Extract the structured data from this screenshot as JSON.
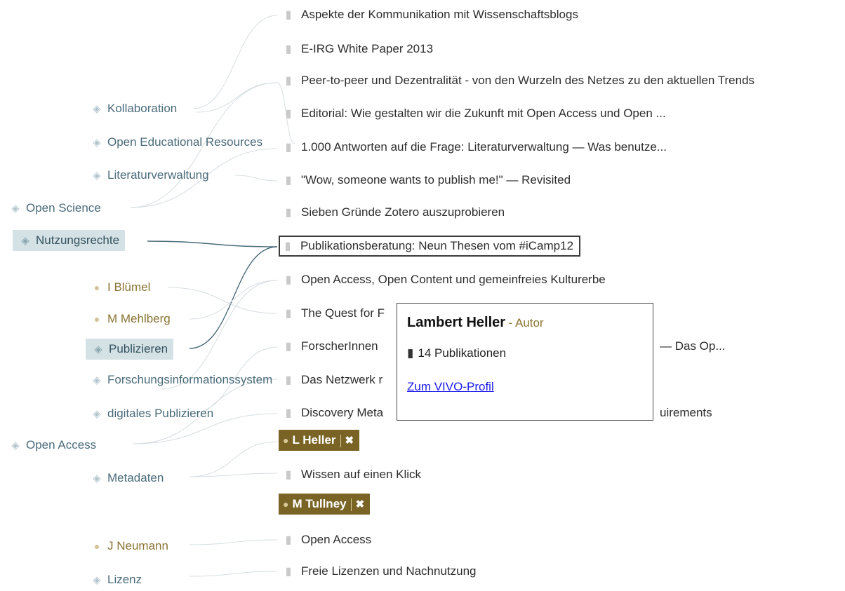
{
  "tags": {
    "kollaboration": "Kollaboration",
    "oer": "Open Educational Resources",
    "literaturverwaltung": "Literaturverwaltung",
    "open_science": "Open Science",
    "nutzungsrechte": "Nutzungsrechte",
    "publizieren": "Publizieren",
    "forschungsinfo": "Forschungsinformationssystem",
    "digitales_publizieren": "digitales Publizieren",
    "open_access": "Open Access",
    "metadaten": "Metadaten",
    "lizenz": "Lizenz"
  },
  "people": {
    "bluemel": "I Blümel",
    "mehlberg": "M Mehlberg",
    "neumann": "J Neumann"
  },
  "selected_authors": [
    {
      "label": "L Heller",
      "close": "✖"
    },
    {
      "label": "M Tullney",
      "close": "✖"
    }
  ],
  "publications": [
    "Aspekte der Kommunikation mit Wissenschaftsblogs",
    "E-IRG White Paper 2013",
    "Peer-to-peer und Dezentralität - von den Wurzeln des Netzes zu den aktuellen Trends",
    "Editorial: Wie gestalten wir die Zukunft mit Open Access und Open ...",
    "1.000 Antworten auf die Frage: Literaturverwaltung — Was benutze...",
    "\"Wow, someone wants to publish me!\" — Revisited",
    "Sieben Gründe Zotero auszuprobieren",
    "Publikationsberatung: Neun Thesen vom #iCamp12",
    "Open Access, Open Content und gemeinfreies Kulturerbe",
    "The Quest for F",
    "ForscherInnen",
    "Das Netzwerk r",
    "Discovery Meta",
    "Wissen auf einen Klick",
    "Open Access",
    "Freie Lizenzen und Nachnutzung"
  ],
  "publication_tails": {
    "forscherinnen": "— Das Op...",
    "discovery": "uirements"
  },
  "popup": {
    "name": "Lambert Heller",
    "role": "- Autor",
    "count": "14 Publikationen",
    "profile_link": "Zum VIVO-Profil"
  },
  "icons": {
    "tag": "tag-icon",
    "person": "person-icon",
    "document": "document-icon",
    "close": "close-icon"
  },
  "colors": {
    "tag_text": "#4a6b7a",
    "selected_tag_bg": "#d4e2e6",
    "person_text": "#8a7435",
    "author_chip_bg": "#7a6425",
    "link_line": "#d6dee1",
    "active_link_line": "#4a6b7a",
    "profile_link": "#1a1aee"
  }
}
